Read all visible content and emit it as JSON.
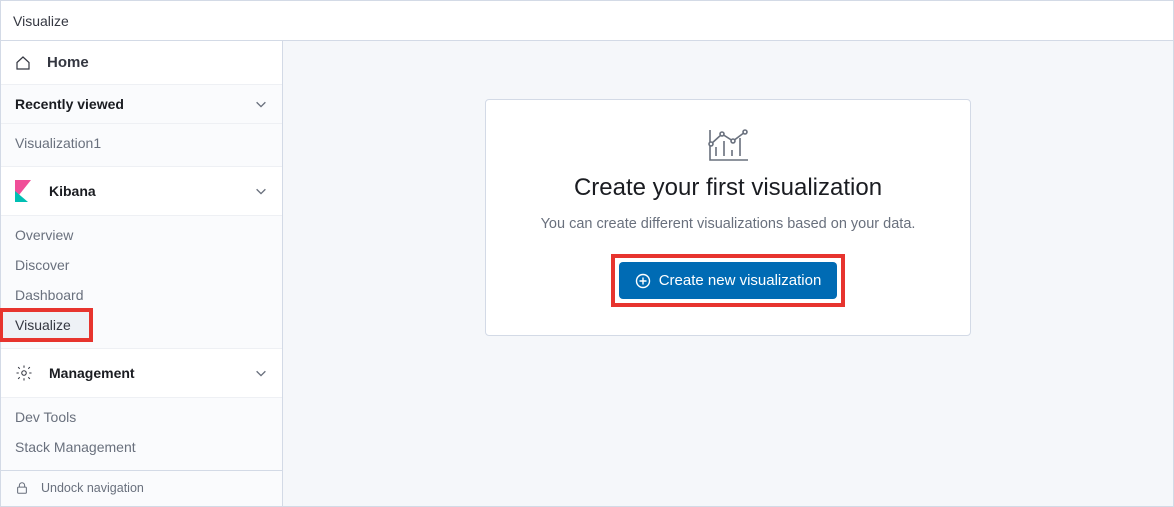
{
  "topbar": {
    "breadcrumb": "Visualize"
  },
  "sidebar": {
    "home": "Home",
    "recently_viewed": {
      "label": "Recently viewed",
      "items": [
        "Visualization1"
      ]
    },
    "kibana": {
      "label": "Kibana",
      "items": [
        "Overview",
        "Discover",
        "Dashboard",
        "Visualize"
      ],
      "active_index": 3
    },
    "management": {
      "label": "Management",
      "items": [
        "Dev Tools",
        "Stack Management"
      ]
    },
    "undock": "Undock navigation"
  },
  "main": {
    "title": "Create your first visualization",
    "subtitle": "You can create different visualizations based on your data.",
    "cta_label": "Create new visualization"
  }
}
